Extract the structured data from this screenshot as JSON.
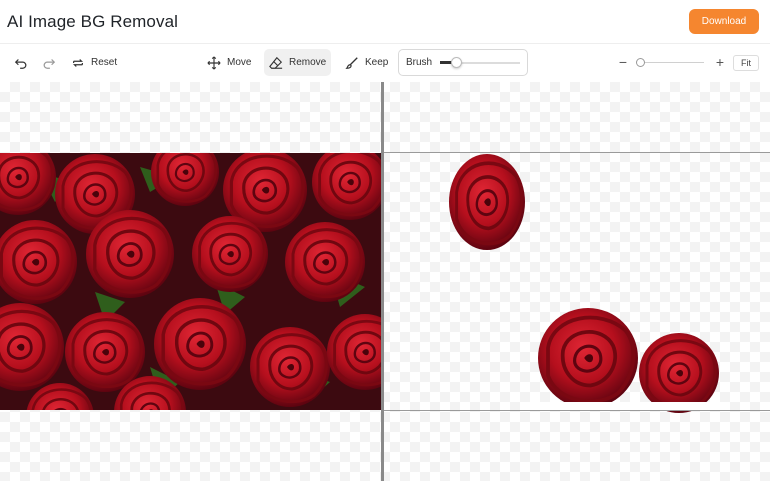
{
  "header": {
    "title": "AI Image BG Removal",
    "download_label": "Download"
  },
  "toolbar": {
    "undo_icon": "undo-icon",
    "redo_icon": "redo-icon",
    "reset_label": "Reset",
    "move_label": "Move",
    "remove_label": "Remove",
    "keep_label": "Keep",
    "brush_label": "Brush",
    "brush_size_fraction": 0.2,
    "zoom_out_label": "−",
    "zoom_in_label": "+",
    "zoom_fraction": 0.0,
    "fit_label": "Fit",
    "active_tool": "Remove"
  },
  "colors": {
    "accent": "#f5862f",
    "rose": "#c0121f",
    "rose_dark": "#6d0510",
    "leaf": "#2f5e1c"
  }
}
